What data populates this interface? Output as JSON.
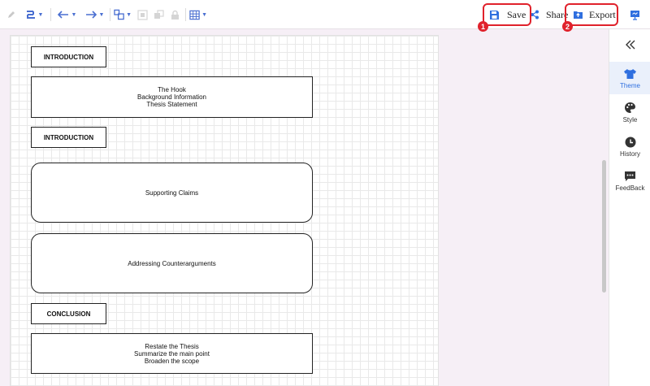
{
  "toolbar": {
    "save_label": "Save",
    "share_label": "Share",
    "export_label": "Export",
    "badge_1": "1",
    "badge_2": "2",
    "icons": [
      "pencil-icon",
      "line-style-icon",
      "arrow-left-icon",
      "arrow-right-icon",
      "resize-icon",
      "group-icon",
      "ungroup-icon",
      "lock-icon",
      "table-icon",
      "save-icon",
      "share-icon",
      "export-icon",
      "present-icon"
    ],
    "accent_color": "#4a6fd1",
    "highlight_color": "#e0222c"
  },
  "canvas": {
    "boxes": [
      {
        "label": "INTRODUCTION"
      },
      {
        "label": "The Hook\nBackground Information\nThesis Statement"
      },
      {
        "label": "INTRODUCTION"
      },
      {
        "label": "Supporting Claims"
      },
      {
        "label": "Addressing Counterarguments"
      },
      {
        "label": "CONCLUSION"
      },
      {
        "label": "Restate the Thesis\nSummarize the main point\nBroaden the scope"
      }
    ]
  },
  "right_panel": {
    "items": [
      {
        "label": "Theme",
        "icon": "shirt-icon",
        "active": true
      },
      {
        "label": "Style",
        "icon": "palette-icon",
        "active": false
      },
      {
        "label": "History",
        "icon": "clock-icon",
        "active": false
      },
      {
        "label": "FeedBack",
        "icon": "feedback-icon",
        "active": false
      }
    ],
    "active_color": "#2f6fdf"
  }
}
